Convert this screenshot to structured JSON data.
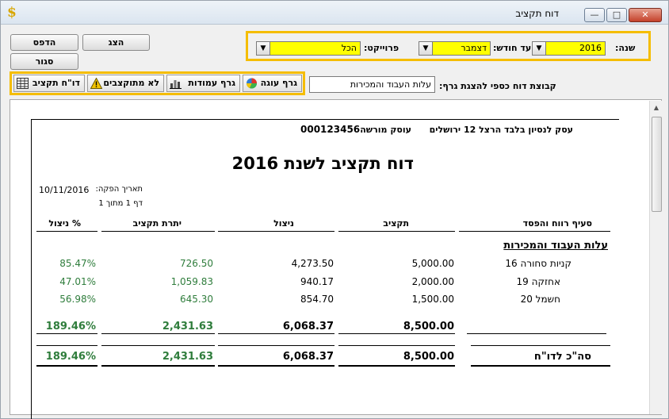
{
  "window": {
    "title": "דוח תקציב",
    "minimize": "—",
    "maximize": "□",
    "close": "✕"
  },
  "toolbar": {
    "show_label": "הצג",
    "print_label": "הדפס",
    "close_label": "סגור"
  },
  "filters": {
    "year_label": "שנה:",
    "year_value": "2016",
    "month_label": "עד חודש:",
    "month_value": "דצמבר",
    "project_label": "פרוייקט:",
    "project_value": "הכל"
  },
  "tabs": [
    {
      "label": "דו\"ח תקציב",
      "icon": "report-grid-icon"
    },
    {
      "label": "לא מתוקצבים",
      "icon": "warning-icon"
    },
    {
      "label": "גרף עמודות",
      "icon": "bar-chart-icon"
    },
    {
      "label": "גרף עוגה",
      "icon": "pie-chart-icon"
    }
  ],
  "graph_group": {
    "label": "קבוצת דוח כספי להצגת גרף:",
    "value": "עלות העבוד והמכירות"
  },
  "report": {
    "business": "עסק לנסיון בלבד הרצל 12 ירושלים",
    "dealer_label": "עוסק מורשה",
    "dealer_number": "000123456",
    "title": "דוח תקציב  לשנת 2016",
    "print_date_label": "תאריך הפקה:",
    "print_date": "10/11/2016",
    "page_info": "דף 1 מתוך 1",
    "columns": {
      "item": "סעיף רווח והפסד",
      "budget": "תקציב",
      "usage": "ניצול",
      "remaining": "יתרת תקציב",
      "percent": "% ניצול"
    },
    "section_title": "עלות העבוד והמכירות",
    "rows": [
      {
        "item": "קניות סחורה 16",
        "budget": "5,000.00",
        "usage": "4,273.50",
        "remaining": "726.50",
        "percent": "85.47%"
      },
      {
        "item": "אחזקה  19",
        "budget": "2,000.00",
        "usage": "940.17",
        "remaining": "1,059.83",
        "percent": "47.01%"
      },
      {
        "item": "חשמל  20",
        "budget": "1,500.00",
        "usage": "854.70",
        "remaining": "645.30",
        "percent": "56.98%"
      }
    ],
    "subtotal": {
      "budget": "8,500.00",
      "usage": "6,068.37",
      "remaining": "2,431.63",
      "percent": "189.46%"
    },
    "total": {
      "label": "סה\"כ לדו\"ח",
      "budget": "8,500.00",
      "usage": "6,068.37",
      "remaining": "2,431.63",
      "percent": "189.46%"
    }
  }
}
